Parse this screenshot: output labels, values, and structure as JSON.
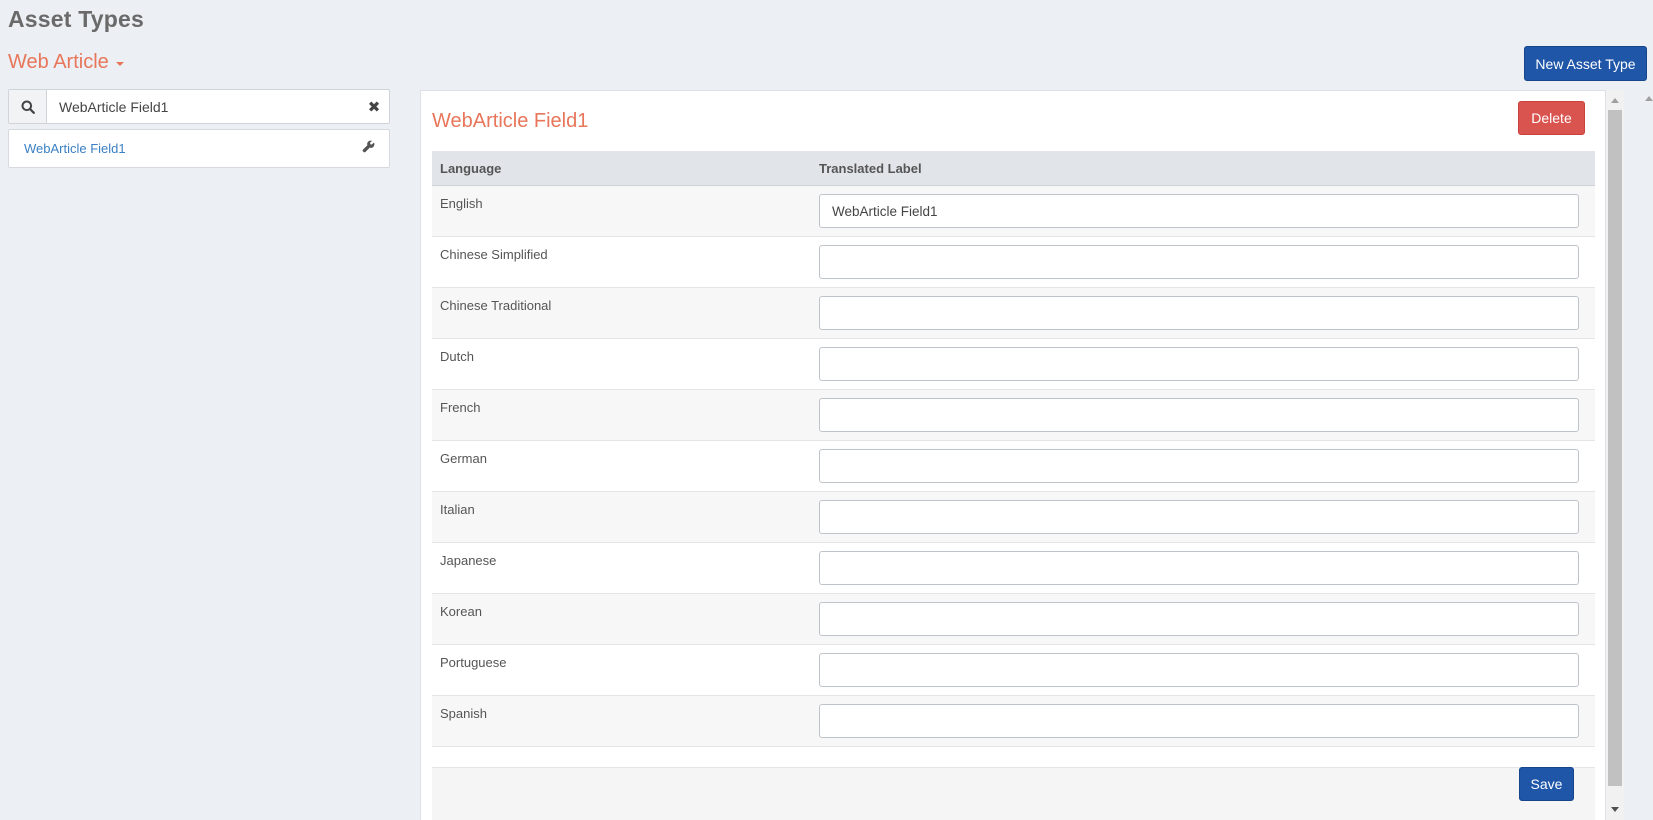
{
  "header": {
    "page_title": "Asset Types",
    "type_selector": "Web Article",
    "new_button": "New Asset Type"
  },
  "search": {
    "value": "WebArticle Field1",
    "icon": "search-icon",
    "clear_icon": "close-icon"
  },
  "results": [
    {
      "label": "WebArticle Field1",
      "icon": "wrench-icon"
    }
  ],
  "detail": {
    "title": "WebArticle Field1",
    "delete_button": "Delete",
    "save_button": "Save",
    "columns": {
      "language": "Language",
      "translated": "Translated Label"
    },
    "rows": [
      {
        "language": "English",
        "value": "WebArticle Field1"
      },
      {
        "language": "Chinese Simplified",
        "value": ""
      },
      {
        "language": "Chinese Traditional",
        "value": ""
      },
      {
        "language": "Dutch",
        "value": ""
      },
      {
        "language": "French",
        "value": ""
      },
      {
        "language": "German",
        "value": ""
      },
      {
        "language": "Italian",
        "value": ""
      },
      {
        "language": "Japanese",
        "value": ""
      },
      {
        "language": "Korean",
        "value": ""
      },
      {
        "language": "Portuguese",
        "value": ""
      },
      {
        "language": "Spanish",
        "value": ""
      }
    ]
  },
  "colors": {
    "accent": "#e8765a",
    "primary_button": "#1f56a8",
    "danger_button": "#d9534f",
    "link": "#3b7fc4"
  }
}
